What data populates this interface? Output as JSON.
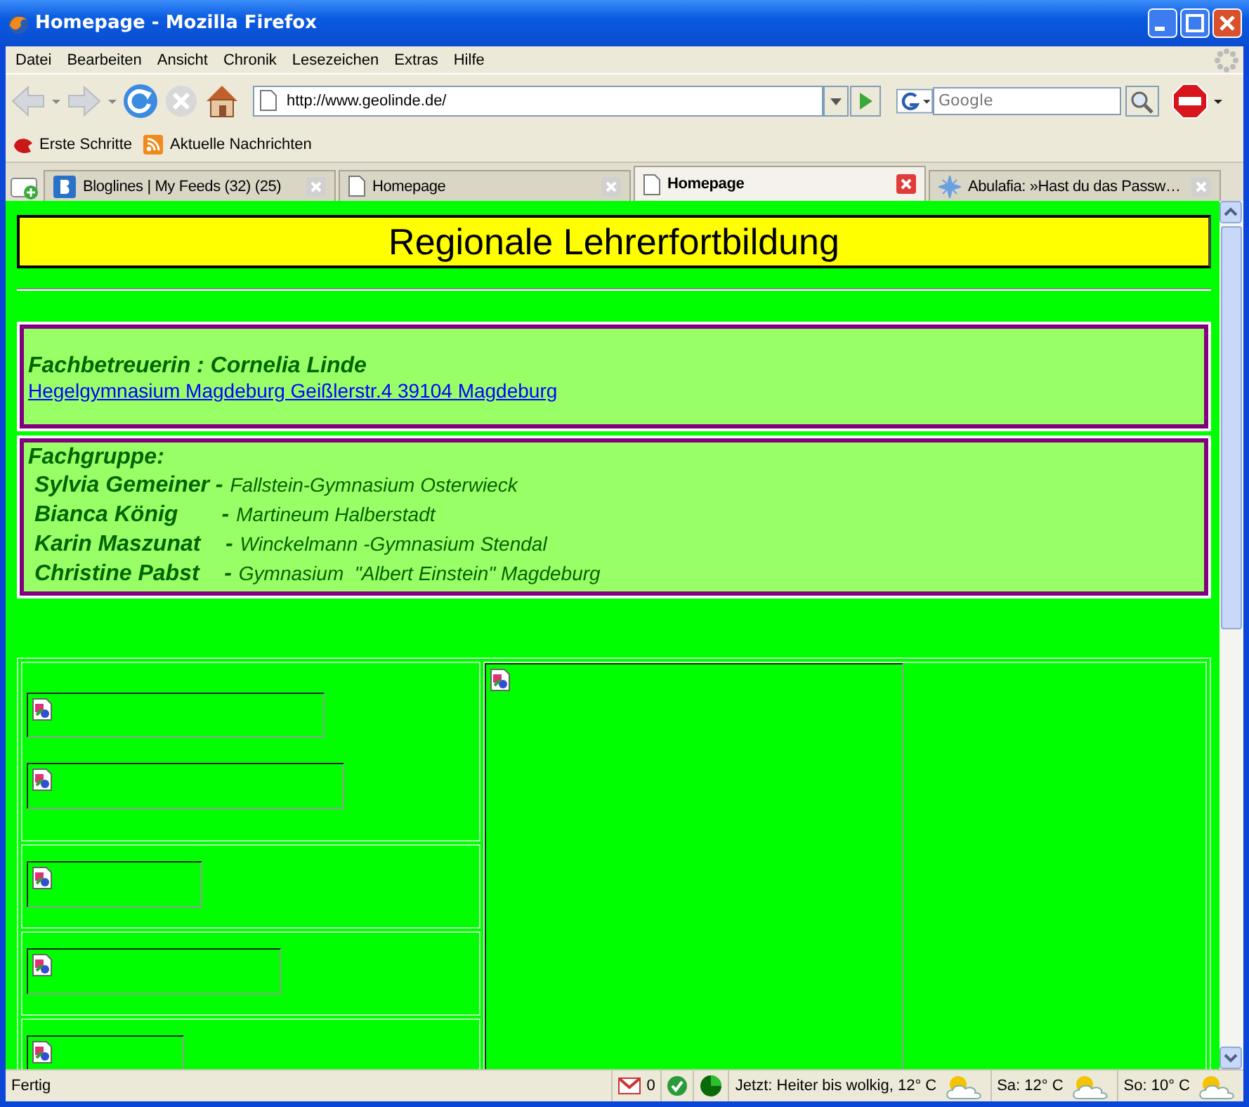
{
  "window": {
    "title": "Homepage - Mozilla Firefox"
  },
  "menu": [
    "Datei",
    "Bearbeiten",
    "Ansicht",
    "Chronik",
    "Lesezeichen",
    "Extras",
    "Hilfe"
  ],
  "navigation": {
    "url": "http://www.geolinde.de/",
    "search_placeholder": "Google"
  },
  "bookmarks": [
    {
      "label": "Erste Schritte",
      "kind": "site"
    },
    {
      "label": "Aktuelle Nachrichten",
      "kind": "feed"
    }
  ],
  "tabs": [
    {
      "label": "Bloglines | My Feeds (32) (25)",
      "kind": "blog",
      "selected": false
    },
    {
      "label": "Homepage",
      "kind": "page",
      "selected": false
    },
    {
      "label": "Homepage",
      "kind": "page",
      "selected": true
    },
    {
      "label": "Abulafia: »Hast du das Passw…",
      "kind": "star",
      "selected": false
    }
  ],
  "page": {
    "heading": "Regionale Lehrerfortbildung",
    "contact": {
      "label": "Fachbetreuerin : Cornelia Linde",
      "link": "Hegelgymnasium Magdeburg Geißlerstr.4 39104 Magdeburg"
    },
    "group": {
      "title": "Fachgruppe:",
      "members": [
        {
          "name": " Sylvia Gemeiner -",
          "school": "Fallstein-Gymnasium Osterwieck"
        },
        {
          "name": " Bianca König       -",
          "school": "Martineum Halberstadt"
        },
        {
          "name": " Karin Maszunat    -",
          "school": "Winckelmann -Gymnasium Stendal"
        },
        {
          "name": " Christine Pabst    -",
          "school": "Gymnasium  \"Albert Einstein\" Magdeburg"
        }
      ]
    }
  },
  "status_bar": {
    "text": "Fertig",
    "mail_count": "0",
    "weather": [
      "Jetzt: Heiter bis wolkig, 12° C",
      "Sa: 12° C",
      "So: 10° C"
    ]
  }
}
